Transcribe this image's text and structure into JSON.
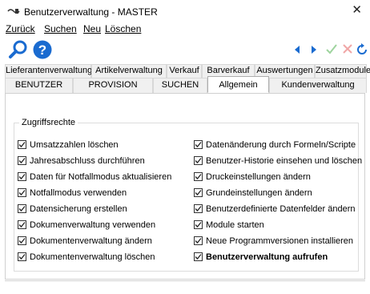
{
  "window": {
    "title": "Benutzerverwaltung - MASTER",
    "close_label": "✕"
  },
  "menu": [
    "Zurück",
    "Suchen",
    "Neu",
    "Löschen"
  ],
  "toolbar": {
    "left_icons": [
      "search-icon",
      "help-icon"
    ],
    "right_icons": [
      "arrow-left-icon",
      "arrow-right-icon",
      "check-icon",
      "cancel-icon",
      "refresh-icon"
    ],
    "colors": {
      "blue": "#1a6bd0",
      "green_disabled": "#9ed49e",
      "red_disabled": "#f0a6a6"
    }
  },
  "tabs": {
    "row1": [
      "Lieferantenverwaltung",
      "Artikelverwaltung",
      "Verkauf",
      "Barverkauf",
      "Auswertungen",
      "Zusatzmodule"
    ],
    "row2": [
      "BENUTZER",
      "PROVISION",
      "SUCHEN",
      "Allgemein",
      "Kundenverwaltung"
    ],
    "active": "Allgemein"
  },
  "group": {
    "title": "Zugriffsrechte",
    "left": [
      {
        "label": "Umsatzzahlen löschen",
        "checked": true
      },
      {
        "label": "Jahresabschluss durchführen",
        "checked": true
      },
      {
        "label": "Daten für Notfallmodus aktualisieren",
        "checked": true
      },
      {
        "label": "Notfallmodus verwenden",
        "checked": true
      },
      {
        "label": "Datensicherung erstellen",
        "checked": true
      },
      {
        "label": "Dokumenverwaltung verwenden",
        "checked": true
      },
      {
        "label": "Dokumentenverwaltung ändern",
        "checked": true
      },
      {
        "label": "Dokumentenverwaltung löschen",
        "checked": true
      }
    ],
    "right": [
      {
        "label": "Datenänderung durch Formeln/Scripte",
        "checked": true
      },
      {
        "label": "Benutzer-Historie einsehen und löschen",
        "checked": true
      },
      {
        "label": "Druckeinstellungen ändern",
        "checked": true
      },
      {
        "label": "Grundeinstellungen ändern",
        "checked": true
      },
      {
        "label": "Benutzerdefinierte Datenfelder ändern",
        "checked": true
      },
      {
        "label": "Module starten",
        "checked": true
      },
      {
        "label": "Neue Programmversionen installieren",
        "checked": true
      },
      {
        "label": "Benutzerverwaltung aufrufen",
        "checked": true,
        "bold": true
      }
    ]
  }
}
